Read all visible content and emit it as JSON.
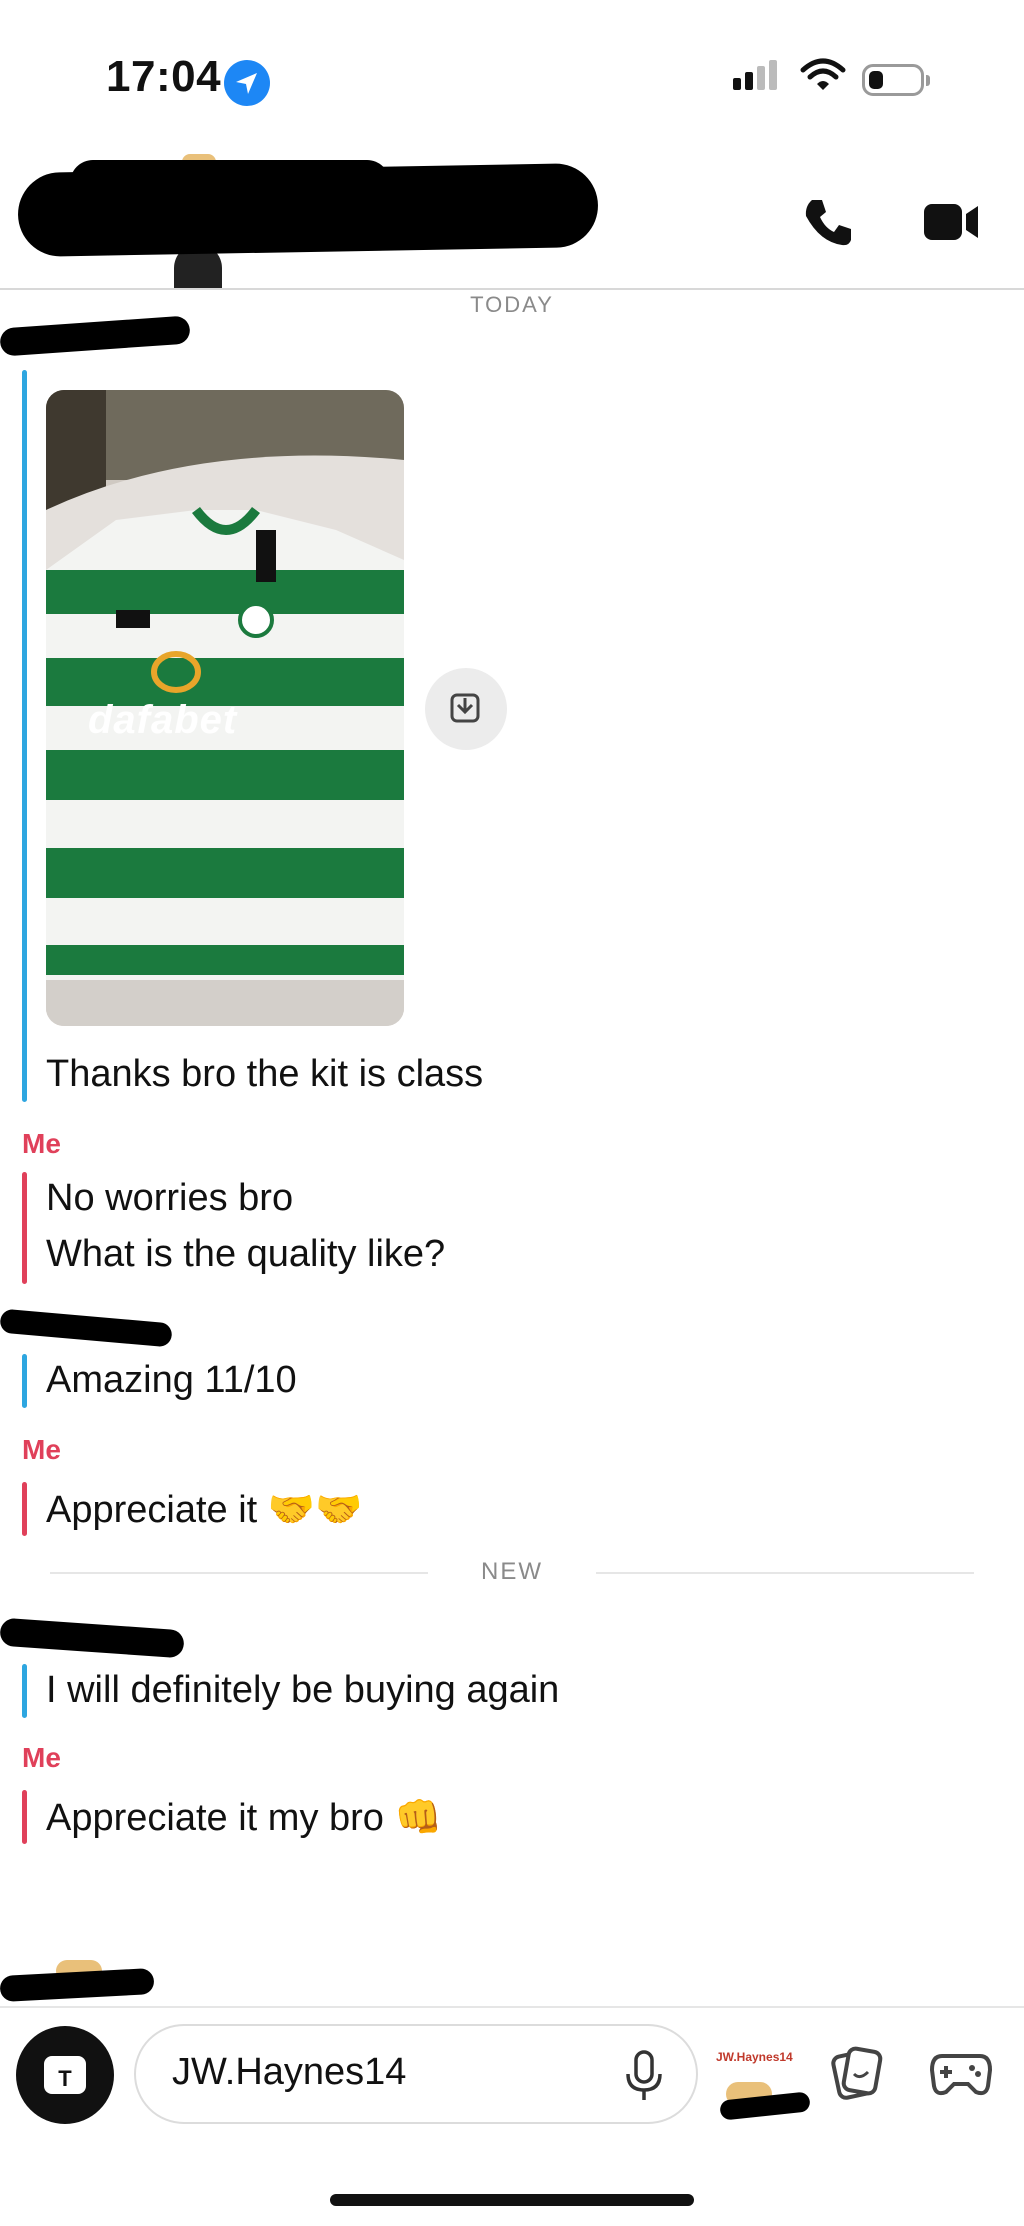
{
  "status": {
    "time": "17:04",
    "battery_level": 0.3
  },
  "header": {
    "back_icon": "chevron-left-icon",
    "call_icon": "phone-icon",
    "video_icon": "video-camera-icon"
  },
  "chat": {
    "day_label": "TODAY",
    "new_label": "NEW",
    "me_label": "Me",
    "photo_brand_text": "dafabet",
    "photo_save_icon": "save-to-chat-icon",
    "messages": [
      {
        "from": "friend",
        "text": "Thanks bro the kit is class"
      },
      {
        "from": "me",
        "text_line1": "No worries bro",
        "text_line2": "What is the quality like?"
      },
      {
        "from": "friend",
        "text": "Amazing 11/10"
      },
      {
        "from": "me",
        "text": "Appreciate it 🤝🤝"
      },
      {
        "from": "friend",
        "text": "I will definitely be buying again"
      },
      {
        "from": "me",
        "text": "Appreciate it my bro 👊"
      }
    ]
  },
  "composer": {
    "camera_icon": "camera-icon",
    "input_value": "JW.Haynes14",
    "mic_icon": "microphone-icon",
    "bitmoji_tag": "JW.Haynes14",
    "sticker_icon": "sticker-icon",
    "game_icon": "game-controller-icon"
  },
  "colors": {
    "friend_accent": "#2ea6e0",
    "me_accent": "#e0405a",
    "jersey_green": "#1b7a3e"
  }
}
